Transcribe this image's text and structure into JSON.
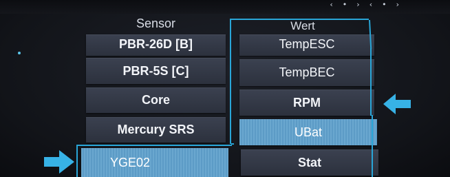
{
  "status_bar": {
    "icons": [
      "signal-icon",
      "signal-icon"
    ]
  },
  "sensor_column": {
    "header": "Sensor",
    "items": [
      {
        "label": "PBR-26D [B]"
      },
      {
        "label": "PBR-5S [C]"
      },
      {
        "label": "Core"
      },
      {
        "label": "Mercury SRS"
      },
      {
        "label": "YGE02",
        "selected": true
      }
    ]
  },
  "value_column": {
    "header": "Wert",
    "items": [
      {
        "label": "TempESC"
      },
      {
        "label": "TempBEC"
      },
      {
        "label": "RPM"
      },
      {
        "label": "UBat",
        "selected": true
      },
      {
        "label": "Stat"
      }
    ]
  },
  "colors": {
    "frame": "#29a6d8",
    "arrow": "#37b2e6",
    "selected": "#64a3cb",
    "button": "#343a47",
    "text": "#f3f5f9"
  }
}
